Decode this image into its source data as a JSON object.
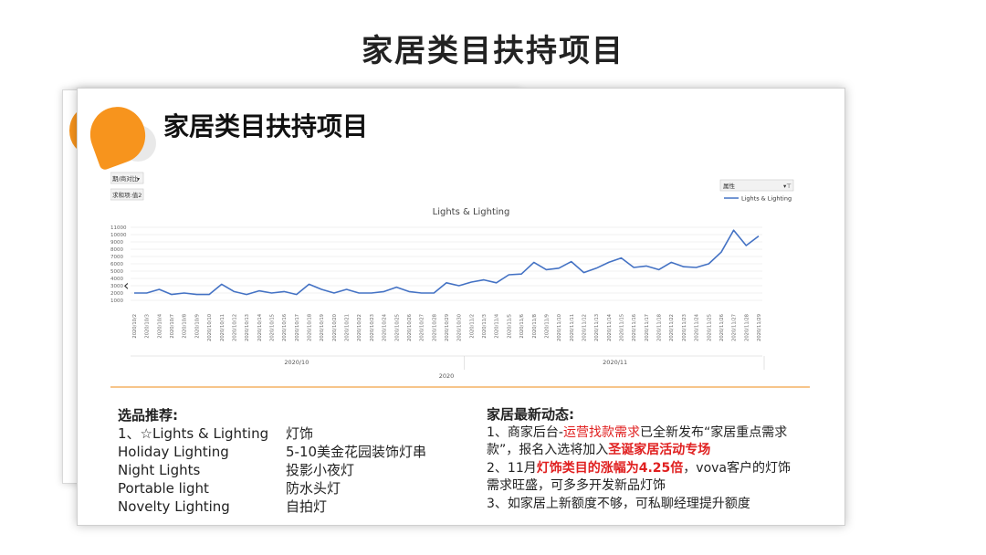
{
  "page": {
    "title": "家居类目扶持项目"
  },
  "slide": {
    "title": "家居类目扶持项目"
  },
  "chart_controls": {
    "filter_label": "期/商对比",
    "sum_label": "求和项:值2",
    "attribute_label": "属性",
    "legend_label": "Lights & Lighting"
  },
  "chart_data": {
    "type": "line",
    "title": "Lights & Lighting",
    "x": [
      "2020/10/2",
      "2020/10/3",
      "2020/10/4",
      "2020/10/7",
      "2020/10/8",
      "2020/10/9",
      "2020/10/10",
      "2020/10/11",
      "2020/10/12",
      "2020/10/13",
      "2020/10/14",
      "2020/10/15",
      "2020/10/16",
      "2020/10/17",
      "2020/10/18",
      "2020/10/19",
      "2020/10/20",
      "2020/10/21",
      "2020/10/22",
      "2020/10/23",
      "2020/10/24",
      "2020/10/25",
      "2020/10/26",
      "2020/10/27",
      "2020/10/28",
      "2020/10/29",
      "2020/10/30",
      "2020/11/2",
      "2020/11/3",
      "2020/11/4",
      "2020/11/5",
      "2020/11/6",
      "2020/11/8",
      "2020/11/9",
      "2020/11/10",
      "2020/11/11",
      "2020/11/12",
      "2020/11/13",
      "2020/11/14",
      "2020/11/15",
      "2020/11/16",
      "2020/11/17",
      "2020/11/18",
      "2020/11/22",
      "2020/11/23",
      "2020/11/24",
      "2020/11/25",
      "2020/11/26",
      "2020/11/27",
      "2020/11/28",
      "2020/11/29"
    ],
    "series": [
      {
        "name": "Lights & Lighting",
        "values": [
          2000,
          2000,
          2500,
          1800,
          2000,
          1800,
          1800,
          3200,
          2200,
          1800,
          2300,
          2000,
          2200,
          1800,
          3200,
          2500,
          2000,
          2500,
          2000,
          2000,
          2200,
          2800,
          2200,
          2000,
          2000,
          3400,
          3000,
          3500,
          3800,
          3400,
          4500,
          4600,
          6200,
          5200,
          5400,
          6300,
          4800,
          5400,
          6200,
          6800,
          5500,
          5700,
          5200,
          6200,
          5600,
          5500,
          6000,
          7600,
          10600,
          8500,
          9800
        ]
      }
    ],
    "ylim": [
      0,
      11000
    ],
    "y_ticks": [
      "1000",
      "2000",
      "3000",
      "4000",
      "5000",
      "6000",
      "7000",
      "8000",
      "9000",
      "10000",
      "11000"
    ],
    "month_labels": [
      {
        "label": "2020/10",
        "from": 0,
        "to": 26
      },
      {
        "label": "2020/11",
        "from": 27,
        "to": 50
      }
    ],
    "year_label": "2020",
    "grid": true,
    "legend": "top-right",
    "color": "#4472c4"
  },
  "products": {
    "title": "选品推荐:",
    "items": [
      {
        "en": "1、☆Lights & Lighting",
        "cn": "灯饰"
      },
      {
        "en": "Holiday Lighting",
        "cn": "5-10美金花园装饰灯串"
      },
      {
        "en": "Night Lights",
        "cn": "投影小夜灯"
      },
      {
        "en": "Portable light",
        "cn": "防水头灯"
      },
      {
        "en": "Novelty Lighting",
        "cn": "自拍灯"
      }
    ]
  },
  "news": {
    "title": "家居最新动态:",
    "line1_a": "1、商家后台-",
    "line1_red": "运营找款需求",
    "line1_b": "已全新发布“家居重点需求款”，报名入选将加入",
    "line1_red_bold": "圣诞家居活动专场",
    "line2_a": "2、11月",
    "line2_red_bold": "灯饰类目的涨幅为4.25倍",
    "line2_b": "，vova客户的灯饰需求旺盛，可多多开发新品灯饰",
    "line3": "3、如家居上新额度不够，可私聊经理提升额度"
  }
}
